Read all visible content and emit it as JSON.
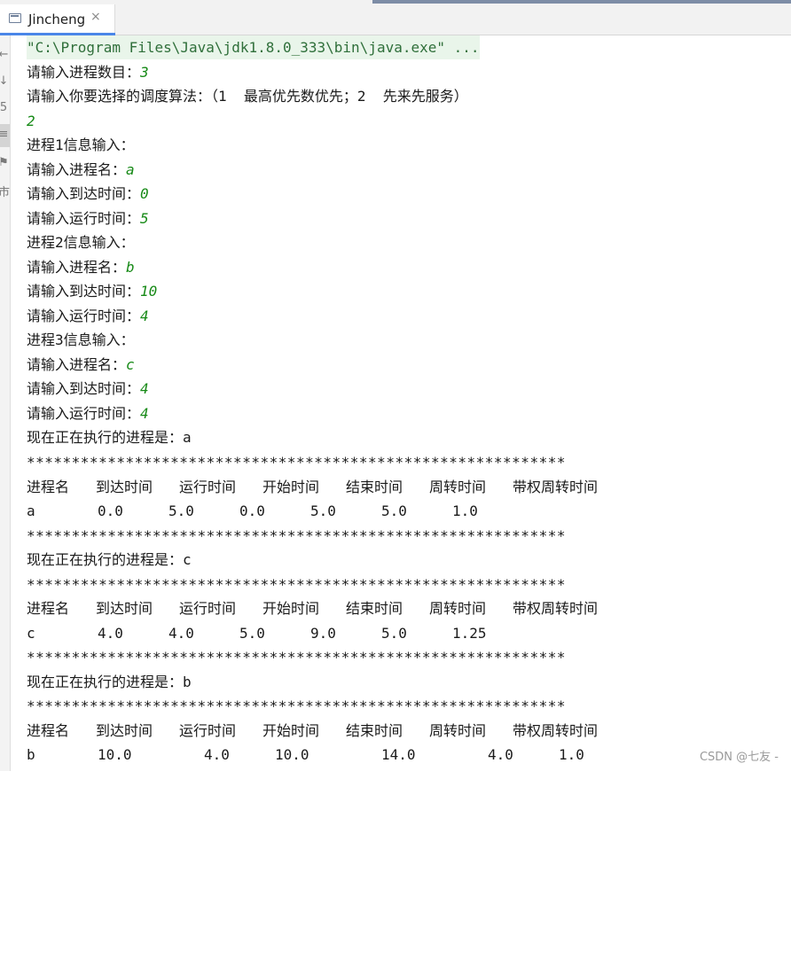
{
  "tab": {
    "title": "Jincheng",
    "close": "×"
  },
  "gutter": {
    "glyphs": [
      "←",
      "↓",
      "5",
      "≡",
      "⚑",
      "市"
    ]
  },
  "console": {
    "command": "\"C:\\Program Files\\Java\\jdk1.8.0_333\\bin\\java.exe\" ...",
    "prompt_count": "请输入进程数目：",
    "input_count": "3",
    "prompt_algo": "请输入你要选择的调度算法：（1  最高优先数优先；2  先来先服务）",
    "input_algo": "2",
    "p1_header": "进程1信息输入：",
    "p1_name_prompt": "请输入进程名：",
    "p1_name": "a",
    "p1_arrive_prompt": "请输入到达时间：",
    "p1_arrive": "0",
    "p1_run_prompt": "请输入运行时间：",
    "p1_run": "5",
    "p2_header": "进程2信息输入：",
    "p2_name_prompt": "请输入进程名：",
    "p2_name": "b",
    "p2_arrive_prompt": "请输入到达时间：",
    "p2_arrive": "10",
    "p2_run_prompt": "请输入运行时间：",
    "p2_run": "4",
    "p3_header": "进程3信息输入：",
    "p3_name_prompt": "请输入进程名：",
    "p3_name": "c",
    "p3_arrive_prompt": "请输入到达时间：",
    "p3_arrive": "4",
    "p3_run_prompt": "请输入运行时间：",
    "p3_run": "4",
    "separator": "************************************************************",
    "headers": [
      "进程名",
      "到达时间",
      "运行时间",
      "开始时间",
      "结束时间",
      "周转时间",
      "带权周转时间"
    ],
    "blocks": [
      {
        "running": "现在正在执行的进程是：a",
        "row": [
          "a",
          "0.0",
          "5.0",
          "0.0",
          "5.0",
          "5.0",
          "1.0"
        ]
      },
      {
        "running": "现在正在执行的进程是：c",
        "row": [
          "c",
          "4.0",
          "4.0",
          "5.0",
          "9.0",
          "5.0",
          "1.25"
        ]
      },
      {
        "running": "现在正在执行的进程是：b",
        "row": [
          "b",
          "10.0",
          "4.0",
          "10.0",
          "14.0",
          "4.0",
          "1.0"
        ]
      }
    ]
  },
  "watermark": "CSDN @七友 -"
}
